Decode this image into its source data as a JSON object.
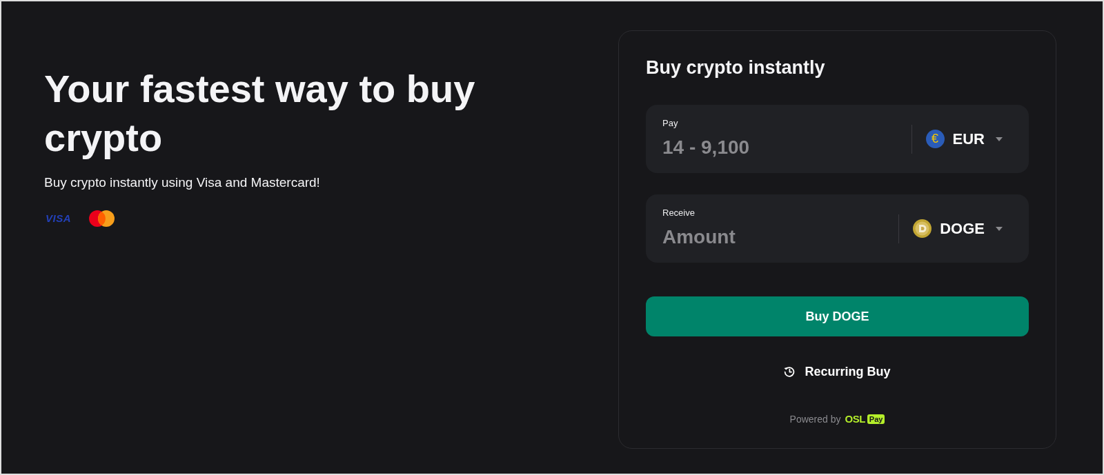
{
  "hero": {
    "title": "Your fastest way to buy crypto",
    "subtitle": "Buy crypto instantly using Visa and Mastercard!",
    "payment_logos": [
      {
        "kind": "visa",
        "text": "VISA"
      },
      {
        "kind": "mastercard"
      }
    ]
  },
  "widget": {
    "title": "Buy crypto instantly",
    "fields": [
      {
        "label": "Pay",
        "placeholder": "14 - 9,100",
        "currency": {
          "code": "EUR",
          "kind": "fiat",
          "symbol": "€"
        }
      },
      {
        "label": "Receive",
        "placeholder": "Amount",
        "currency": {
          "code": "DOGE",
          "kind": "coin"
        }
      }
    ],
    "buy_button": "Buy DOGE",
    "recurring_link": "Recurring Buy",
    "footer": {
      "text": "Powered by",
      "brand": "OSL",
      "badge": "Pay"
    }
  }
}
